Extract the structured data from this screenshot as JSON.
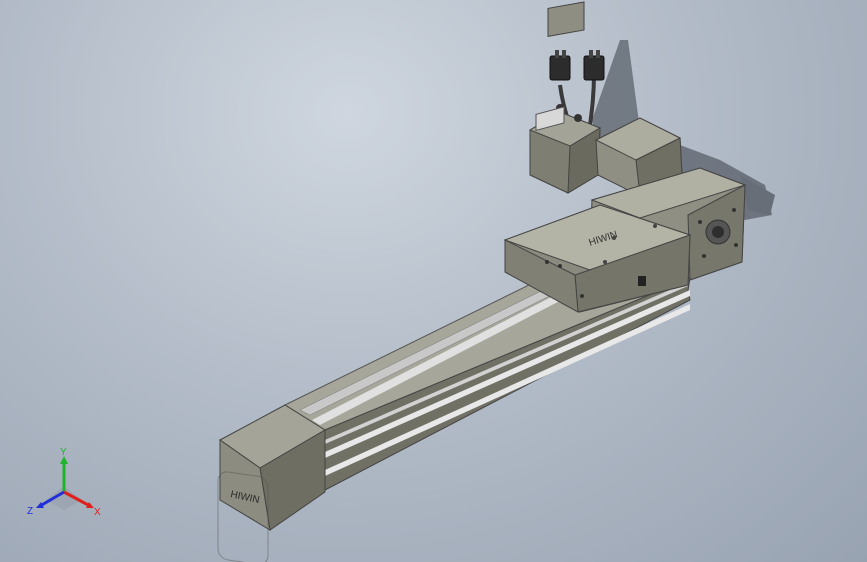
{
  "viewport": {
    "background_top": "#cfd6df",
    "background_bottom": "#98a3b2"
  },
  "model": {
    "body_color": "#8c8c80",
    "body_dark": "#5f5f55",
    "body_light": "#a7a79b",
    "rail_color": "#e8e8e8",
    "carriage_logo": "HIWIN",
    "endcap_logo": "HIWIN"
  },
  "triad": {
    "x_label": "X",
    "y_label": "Y",
    "z_label": "Z",
    "x_color": "#e0201c",
    "y_color": "#1fb52a",
    "z_color": "#2030d8"
  }
}
